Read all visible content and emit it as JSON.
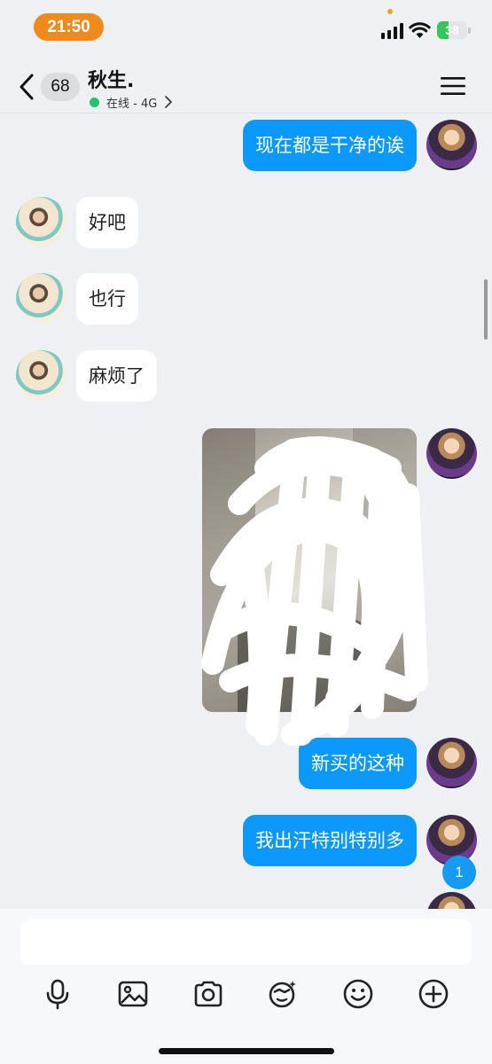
{
  "status_bar": {
    "time": "21:50",
    "battery": "38",
    "battery_level": 0.38,
    "colors": {
      "time_pill": "#f08a1c",
      "battery_fill": "#34c759"
    }
  },
  "header": {
    "unread_count": "68",
    "contact_name": "秋生.",
    "presence": "在线 - 4G",
    "icons": [
      "back-chevron-icon",
      "menu-icon",
      "chevron-right-icon"
    ]
  },
  "messages": [
    {
      "direction": "outgoing",
      "type": "text",
      "text": "现在都是干净的诶"
    },
    {
      "direction": "incoming",
      "type": "text",
      "text": "好吧"
    },
    {
      "direction": "incoming",
      "type": "text",
      "text": "也行"
    },
    {
      "direction": "incoming",
      "type": "text",
      "text": "麻烦了"
    },
    {
      "direction": "outgoing",
      "type": "image"
    },
    {
      "direction": "outgoing",
      "type": "text",
      "text": "新买的这种"
    },
    {
      "direction": "outgoing",
      "type": "text",
      "text": "我出汗特别特别多"
    },
    {
      "direction": "outgoing",
      "type": "text",
      "text": ""
    }
  ],
  "new_messages_badge": "1",
  "composer": {
    "input_value": "",
    "tools": [
      "microphone-icon",
      "image-icon",
      "camera-icon",
      "sticker-icon",
      "emoji-icon",
      "plus-icon"
    ]
  },
  "colors": {
    "outgoing_bubble": "#0b99ff",
    "incoming_bubble": "#ffffff",
    "background": "#eff0f3",
    "online": "#1fc56b"
  }
}
